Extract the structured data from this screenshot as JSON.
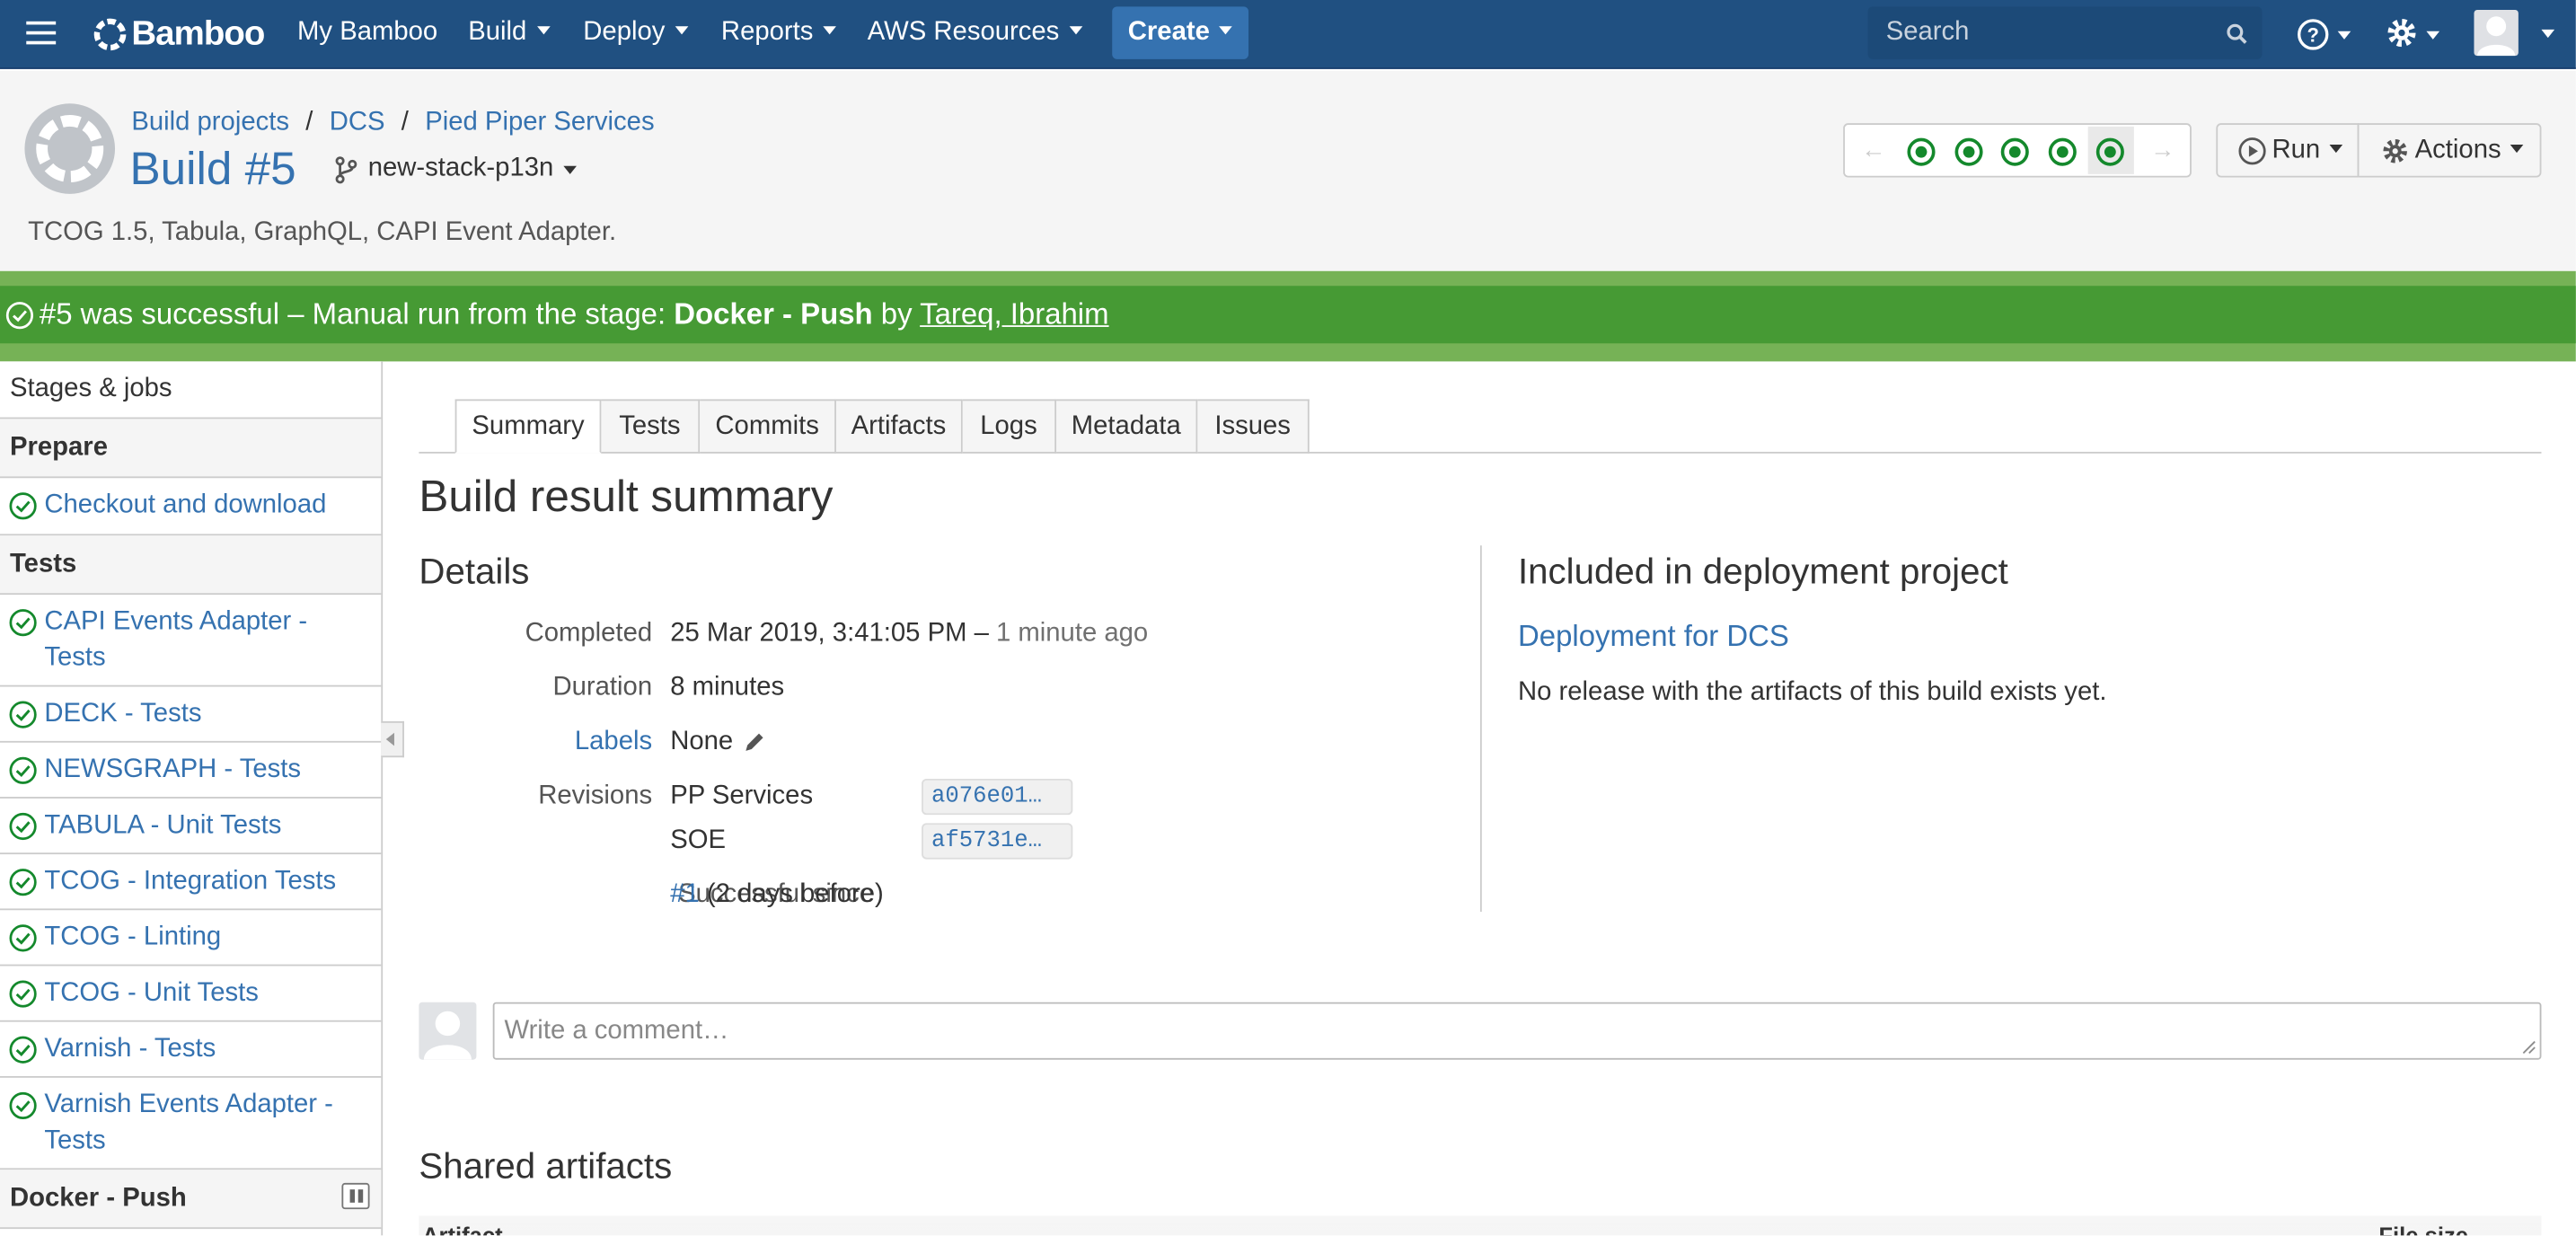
{
  "nav": {
    "logo_text": "Bamboo",
    "items": [
      {
        "label": "My Bamboo"
      },
      {
        "label": "Build"
      },
      {
        "label": "Deploy"
      },
      {
        "label": "Reports"
      },
      {
        "label": "AWS Resources"
      }
    ],
    "create_label": "Create",
    "search_placeholder": "Search"
  },
  "header": {
    "breadcrumb": [
      "Build projects",
      "DCS",
      "Pied Piper Services"
    ],
    "title": "Build #5",
    "branch": "new-stack-p13n",
    "description": "TCOG 1.5, Tabula, GraphQL, CAPI Event Adapter.",
    "run_label": "Run",
    "actions_label": "Actions",
    "history_count": 5
  },
  "status": {
    "prefix": "#5 was successful – Manual run from the stage: ",
    "stage": "Docker - Push",
    "by": " by ",
    "user": "Tareq, Ibrahim",
    "color": "#469a34"
  },
  "sidebar": {
    "heading": "Stages & jobs",
    "stages": [
      {
        "name": "Prepare",
        "jobs": [
          "Checkout and download"
        ]
      },
      {
        "name": "Tests",
        "jobs": [
          "CAPI Events Adapter - Tests",
          "DECK - Tests",
          "NEWSGRAPH - Tests",
          "TABULA - Unit Tests",
          "TCOG - Integration Tests",
          "TCOG - Linting",
          "TCOG - Unit Tests",
          "Varnish - Tests",
          "Varnish Events Adapter - Tests"
        ]
      },
      {
        "name": "Docker - Push",
        "jobs": []
      }
    ]
  },
  "tabs": [
    "Summary",
    "Tests",
    "Commits",
    "Artifacts",
    "Logs",
    "Metadata",
    "Issues"
  ],
  "summary": {
    "title": "Build result summary",
    "details_heading": "Details",
    "completed_label": "Completed",
    "completed_value": "25 Mar 2019, 3:41:05 PM – ",
    "completed_relative": "1 minute ago",
    "duration_label": "Duration",
    "duration_value": "8 minutes",
    "labels_label": "Labels",
    "labels_value": "None",
    "revisions_label": "Revisions",
    "revisions": [
      {
        "repo": "PP Services",
        "hash": "a076e01…"
      },
      {
        "repo": "SOE",
        "hash": "af5731e…"
      }
    ],
    "since_label": "Successful since",
    "since_link": "#1",
    "since_rest": " (2 days before)"
  },
  "deployment": {
    "heading": "Included in deployment project",
    "link": "Deployment for DCS",
    "note": "No release with the artifacts of this build exists yet."
  },
  "comment": {
    "placeholder": "Write a comment…"
  },
  "artifacts": {
    "heading": "Shared artifacts",
    "col1": "Artifact",
    "col2": "File size"
  }
}
